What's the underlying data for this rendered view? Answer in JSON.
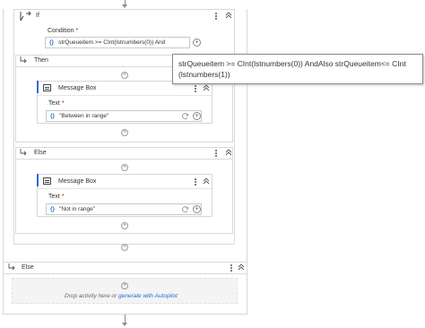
{
  "if_block": {
    "title": "If",
    "condition_label": "Condition",
    "condition_value": "strQueueitem >= CInt(lstnumbers(0)) And"
  },
  "tooltip": {
    "text": "strQueueitem >= CInt(lstnumbers(0)) AndAlso strQueueitem<= CInt (lstnumbers(1))"
  },
  "then_branch": {
    "title": "Then",
    "message_box": {
      "title": "Message Box",
      "text_label": "Text",
      "text_value": "\"Between in range\""
    }
  },
  "inner_else_branch": {
    "title": "Else",
    "message_box": {
      "title": "Message Box",
      "text_label": "Text",
      "text_value": "\"Not in range\""
    }
  },
  "outer_else_branch": {
    "title": "Else",
    "drop_hint": "Drop activity here or",
    "autopilot_link": "generate with Autopilot"
  },
  "common": {
    "required_mark": "*",
    "expression_brace": "{}",
    "plus": "+"
  },
  "colors": {
    "accent": "#2d6bd6",
    "border": "#d6d6d6",
    "required": "#cc0000"
  }
}
